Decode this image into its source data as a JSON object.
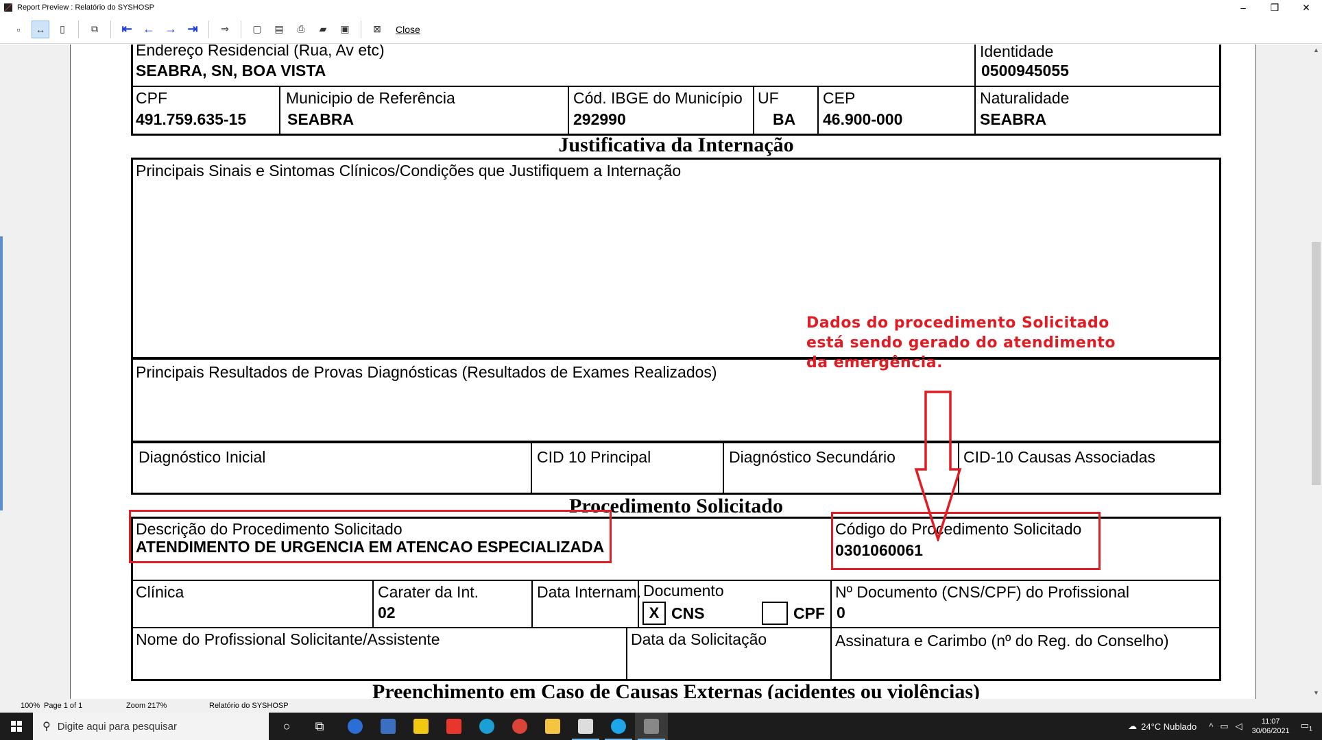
{
  "window": {
    "title": "Report Preview : Relatório do SYSHOSP",
    "minimize": "–",
    "restore": "❐",
    "close": "✕"
  },
  "toolbar": {
    "close_label": "Close"
  },
  "report": {
    "endereco_label": "Endereço Residencial (Rua, Av etc)",
    "endereco_value": "SEABRA, SN, BOA VISTA",
    "identidade_label": "Identidade",
    "identidade_value": "0500945055",
    "cpf_label": "CPF",
    "cpf_value": "491.759.635-15",
    "municipio_label": "Municipio de Referência",
    "municipio_value": "SEABRA",
    "ibge_label": "Cód. IBGE do Município",
    "ibge_value": "292990",
    "uf_label": "UF",
    "uf_value": "BA",
    "cep_label": "CEP",
    "cep_value": "46.900-000",
    "naturalidade_label": "Naturalidade",
    "naturalidade_value": "SEABRA",
    "justificativa_heading": "Justificativa da Internação",
    "sinais_label": "Principais Sinais e Sintomas Clínicos/Condições que Justifiquem a Internação",
    "resultados_label": "Principais Resultados de Provas Diagnósticas (Resultados de Exames Realizados)",
    "diag_inicial_label": "Diagnóstico Inicial",
    "cid_principal_label": "CID 10 Principal",
    "diag_secundario_label": "Diagnóstico Secundário",
    "cid_causas_label": "CID-10 Causas Associadas",
    "procedimento_heading": "Procedimento Solicitado",
    "descricao_label": "Descrição do Procedimento Solicitado",
    "descricao_value": "ATENDIMENTO DE URGENCIA EM ATENCAO ESPECIALIZADA",
    "codigo_label": "Código do Procedimento Solicitado",
    "codigo_value": "0301060061",
    "clinica_label": "Clínica",
    "carater_label": "Carater da Int.",
    "carater_value": "02",
    "data_internam_label": "Data Internam.",
    "documento_label": "Documento",
    "doc_cns_mark": "X",
    "doc_cns_label": "CNS",
    "doc_cpf_label": "CPF",
    "nro_documento_label": "Nº Documento (CNS/CPF) do Profissional",
    "nro_documento_value": "0",
    "profissional_label": "Nome do Profissional Solicitante/Assistente",
    "data_solicitacao_label": "Data da Solicitação",
    "assinatura_label": "Assinatura e Carimbo (nº do Reg. do Conselho)",
    "causas_externas_heading": "Preenchimento em Caso de Causas Externas (acidentes ou violências)"
  },
  "annotation": {
    "line1": "Dados do procedimento Solicitado",
    "line2": "está sendo gerado do atendimento",
    "line3": "da emergência."
  },
  "statusbar": {
    "zoom_percent": "100%",
    "page": "Page 1 of 1",
    "zoom": "Zoom 217%",
    "report_name": "Relatório do SYSHOSP"
  },
  "taskbar": {
    "search_placeholder": "Digite aqui para pesquisar",
    "weather": "24°C  Nublado",
    "time": "11:07",
    "date": "30/06/2021",
    "notifications": "1"
  }
}
